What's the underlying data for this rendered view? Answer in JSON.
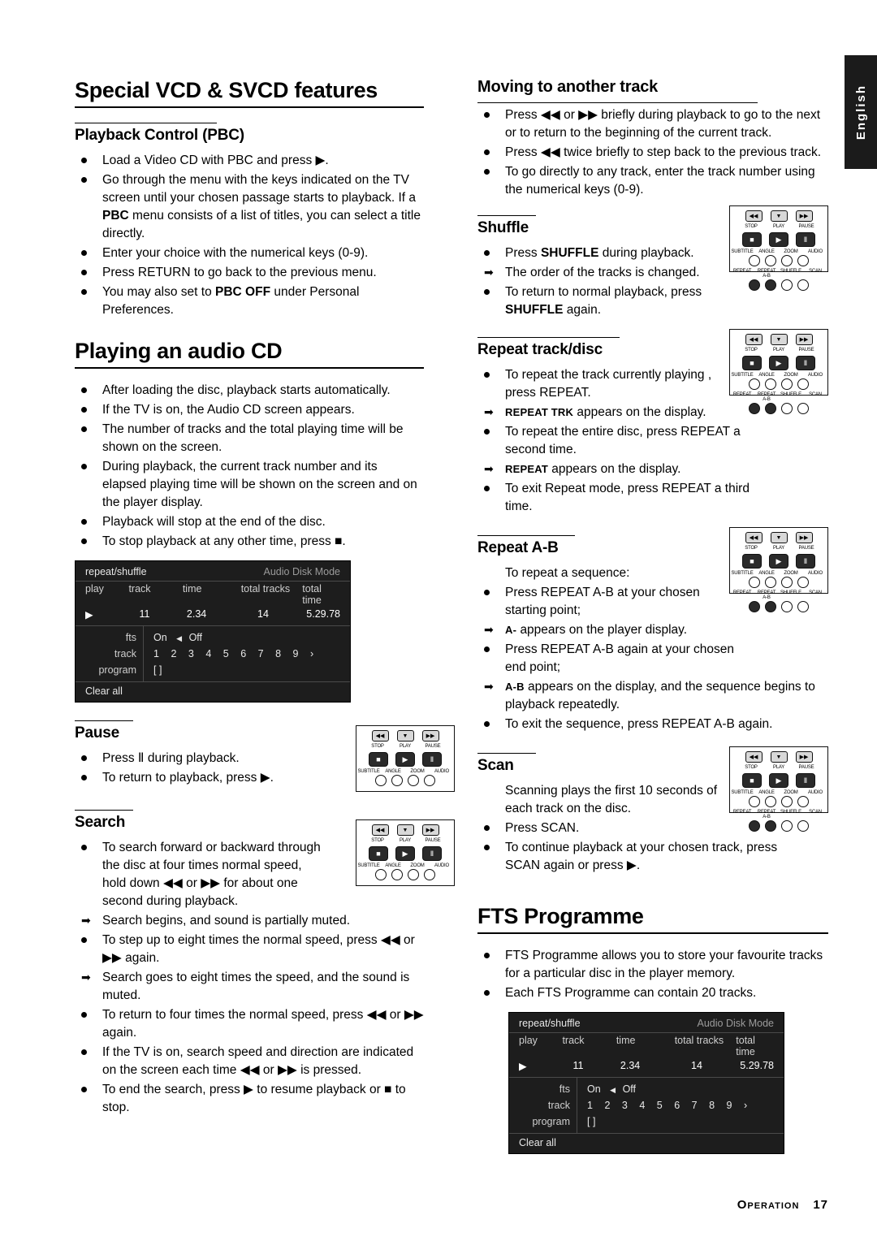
{
  "lang_tab": "English",
  "footer": {
    "section": "Operation",
    "page": "17"
  },
  "left": {
    "h_special": "Special VCD & SVCD features",
    "h_pbc": "Playback Control (PBC)",
    "pbc_items": [
      "Load a Video CD with PBC and press ▶.",
      "Go through the menu with the keys indicated on the TV screen until your chosen passage starts to playback. If a PBC menu consists of a list of titles, you can select a title directly.",
      "Enter your choice with the numerical keys (0-9).",
      "Press RETURN to go back to the previous menu.",
      "You may also set to PBC OFF under Personal Preferences."
    ],
    "h_audiocd": "Playing an audio CD",
    "audiocd_items": [
      "After loading the disc, playback starts automatically.",
      "If the TV is on, the Audio CD screen appears.",
      "The number of tracks and the total playing time will be shown on the screen.",
      "During playback, the current track number and its elapsed playing time will be shown on the screen and on the player display.",
      "Playback will stop at the end of the disc.",
      "To stop playback at any other time, press ■."
    ],
    "h_pause": "Pause",
    "pause_items": [
      "Press Ⅱ during playback.",
      "To return to playback, press ▶."
    ],
    "h_search": "Search",
    "search_items": [
      "To search forward or backward through the disc at four times normal speed, hold down ◀◀ or ▶▶ for about one second during playback.",
      "To step up to eight times the normal speed, press ◀◀ or ▶▶ again.",
      "To return to four times the normal speed, press ◀◀ or ▶▶ again.",
      "If the TV is on, search speed and direction are indicated on the screen each time ◀◀ or ▶▶ is pressed.",
      "To end the search, press ▶ to resume playback or ■ to stop."
    ],
    "search_arrow_1": "Search begins, and sound is partially muted.",
    "search_arrow_2": "Search goes to eight times the speed, and the sound is muted."
  },
  "right": {
    "h_moving": "Moving to another track",
    "moving_items": [
      "Press ◀◀ or ▶▶ briefly during playback to go to the next or to return to the beginning of the current track.",
      "Press ◀◀ twice briefly to step back to the previous track.",
      "To go directly to any track, enter the track number using the numerical keys (0-9)."
    ],
    "h_shuffle": "Shuffle",
    "shuffle_items": [
      "Press SHUFFLE during playback.",
      "To return to normal playback, press SHUFFLE again."
    ],
    "shuffle_arrow": "The order of the tracks is changed.",
    "h_repeat_td": "Repeat track/disc",
    "repeat_items": [
      "To repeat the track currently playing , press REPEAT.",
      "To repeat the entire disc, press REPEAT a second time.",
      "To exit Repeat mode, press REPEAT a third time."
    ],
    "repeat_arrow_1_a": "REPEAT TRK",
    "repeat_arrow_1_b": "appears on the display.",
    "repeat_arrow_2_a": "REPEAT",
    "repeat_arrow_2_b": "appears on the display.",
    "h_repeat_ab": "Repeat A-B",
    "repeat_ab_intro": "To repeat a sequence:",
    "repeat_ab_items": [
      "Press REPEAT A-B at your chosen starting point;",
      "Press REPEAT A-B again at your chosen end point;",
      "To exit the sequence, press REPEAT A-B again."
    ],
    "repeat_ab_arrow_1_a": "A-",
    "repeat_ab_arrow_1_b": "appears on the player display.",
    "repeat_ab_arrow_2_a": "A-B",
    "repeat_ab_arrow_2_b": "appears on the display, and the sequence begins to playback repeatedly.",
    "h_scan": "Scan",
    "scan_intro": "Scanning plays the first 10 seconds of each track on the disc.",
    "scan_items": [
      "Press SCAN.",
      "To continue playback at your chosen track, press SCAN again or press ▶."
    ],
    "h_fts": "FTS Programme",
    "fts_items": [
      "FTS Programme allows you to store your favourite tracks for a particular disc in the player memory.",
      "Each FTS Programme can contain 20 tracks."
    ]
  },
  "osd": {
    "title_left": "repeat/shuffle",
    "title_right": "Audio Disk Mode",
    "columns": [
      "play",
      "track",
      "time",
      "total tracks",
      "total time"
    ],
    "values": [
      "▶",
      "11",
      "2.34",
      "14",
      "5.29.78"
    ],
    "row_labels": [
      "fts",
      "track",
      "program"
    ],
    "fts_on": "On",
    "fts_off": "Off",
    "track_numbers": [
      "1",
      "2",
      "3",
      "4",
      "5",
      "6",
      "7",
      "8",
      "9"
    ],
    "track_more": "›",
    "program_value": "[ ]",
    "clear_all": "Clear all"
  },
  "remote": {
    "top_labels": [
      "◀◀",
      "▼",
      "▶▶"
    ],
    "mid_labels": [
      "STOP",
      "PLAY",
      "PAUSE"
    ],
    "mid_glyphs": [
      "■",
      "▶",
      "Ⅱ"
    ],
    "row3_labels": [
      "SUBTITLE",
      "ANGLE",
      "ZOOM",
      "AUDIO"
    ],
    "row4_labels": [
      "REPEAT",
      "REPEAT A-B",
      "SHUFFLE",
      "SCAN"
    ]
  }
}
